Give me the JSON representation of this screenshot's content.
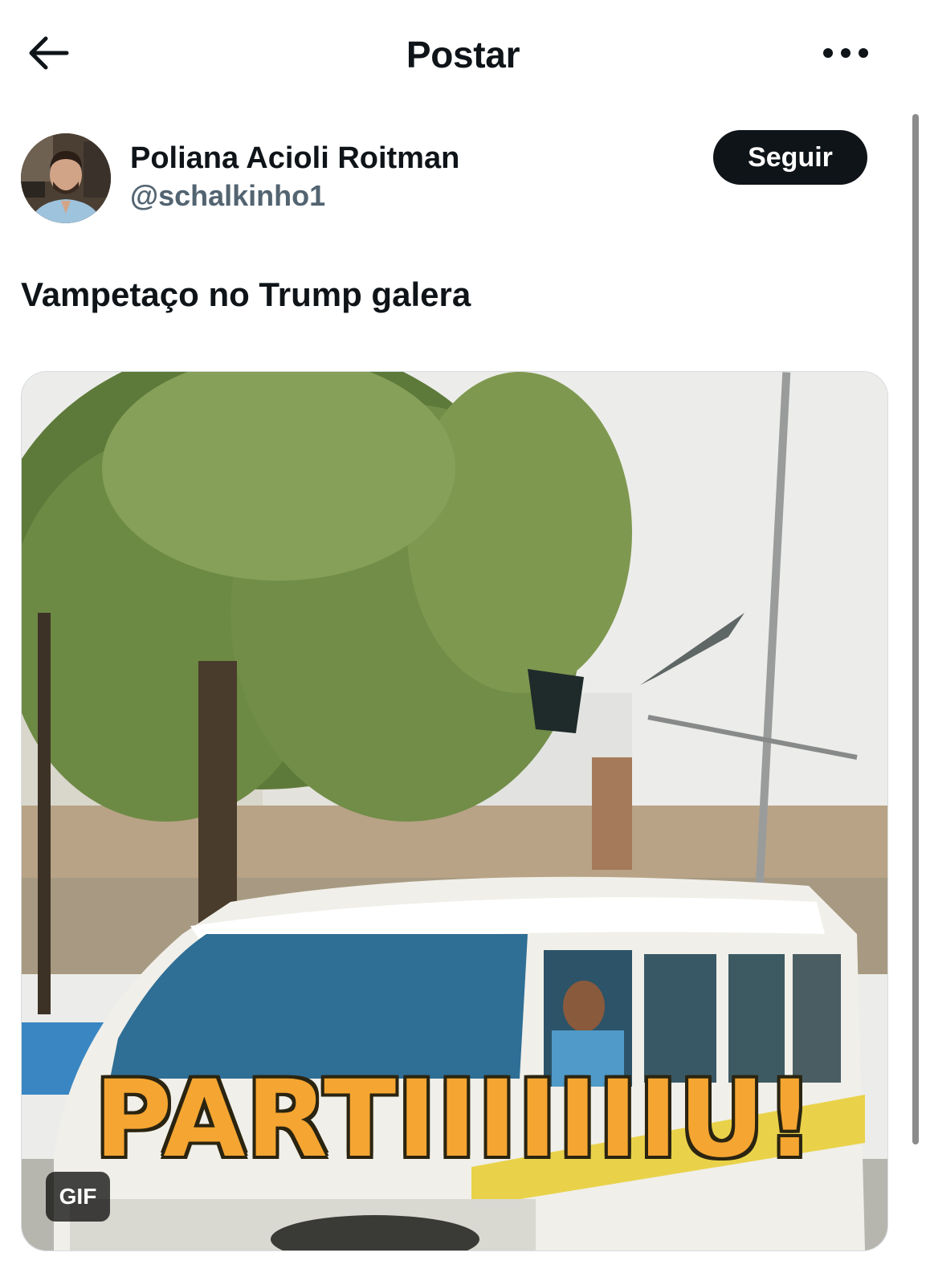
{
  "header": {
    "title": "Postar",
    "back_icon": "arrow-left-icon",
    "more_icon": "more-horizontal-icon"
  },
  "author": {
    "name": "Poliana Acioli Roitman",
    "handle": "@schalkinho1",
    "follow_label": "Seguir"
  },
  "post": {
    "text": "Vampetaço no Trump galera",
    "media": {
      "type": "gif",
      "caption": "PARTIIIIIIIU!",
      "badge": "GIF"
    }
  },
  "colors": {
    "text_primary": "#0f1419",
    "text_secondary": "#536471",
    "follow_button_bg": "#0f1419",
    "caption_fill": "#f5a531"
  }
}
